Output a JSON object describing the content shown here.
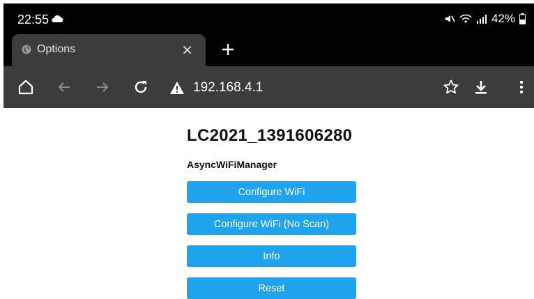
{
  "status_bar": {
    "time": "22:55",
    "battery": "42%"
  },
  "tab": {
    "title": "Options"
  },
  "toolbar": {
    "url": "192.168.4.1"
  },
  "page": {
    "title": "LC2021_1391606280",
    "subtitle": "AsyncWiFiManager",
    "buttons": [
      "Configure WiFi",
      "Configure WiFi (No Scan)",
      "Info",
      "Reset"
    ]
  },
  "colors": {
    "button": "#1fa3ec",
    "toolbar": "#3c3c3c",
    "statusbar": "#000000"
  }
}
